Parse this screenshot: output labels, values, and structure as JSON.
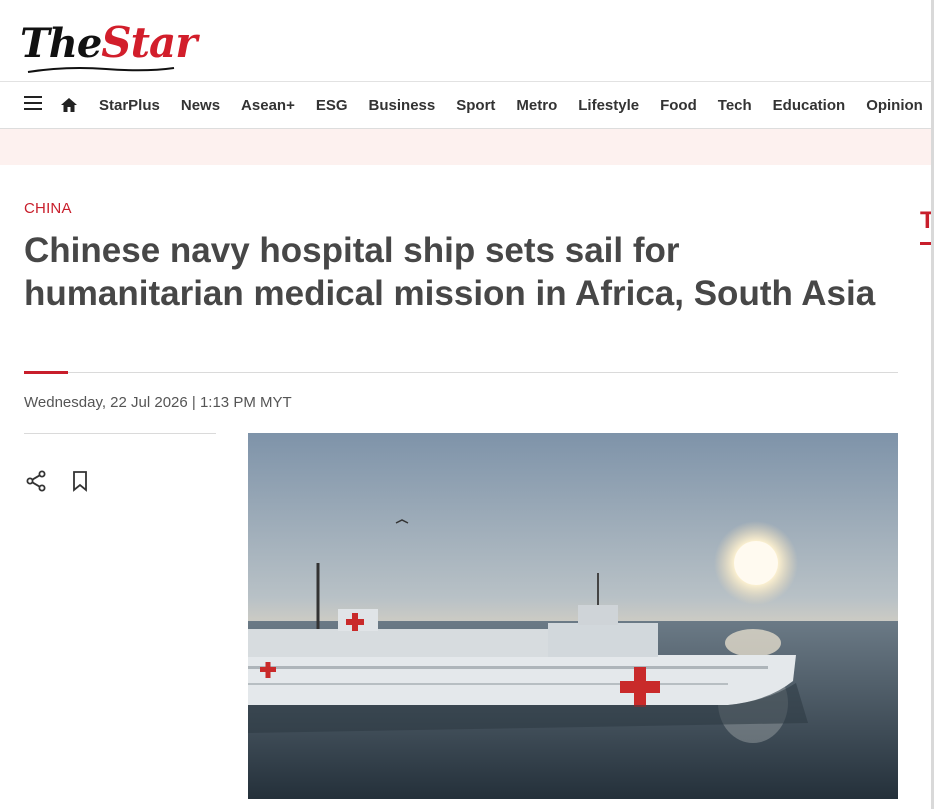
{
  "brand": {
    "logo_word_1": "The",
    "logo_word_2": "Star",
    "accent_color": "#c81e2b"
  },
  "nav": {
    "menu_icon": "hamburger-menu-icon",
    "home_icon": "home-icon",
    "items": [
      "StarPlus",
      "News",
      "Asean+",
      "ESG",
      "Business",
      "Sport",
      "Metro",
      "Lifestyle",
      "Food",
      "Tech",
      "Education",
      "Opinion"
    ]
  },
  "article": {
    "section": "CHINA",
    "headline": "Chinese navy hospital ship sets sail for humanitarian medical mission in Africa, South Asia",
    "dateline": "Wednesday, 22 Jul 2026 | 1:13 PM MYT",
    "share_icon": "share-icon",
    "bookmark_icon": "bookmark-icon"
  },
  "sidebar": {
    "cut_off_heading_letter": "T"
  }
}
